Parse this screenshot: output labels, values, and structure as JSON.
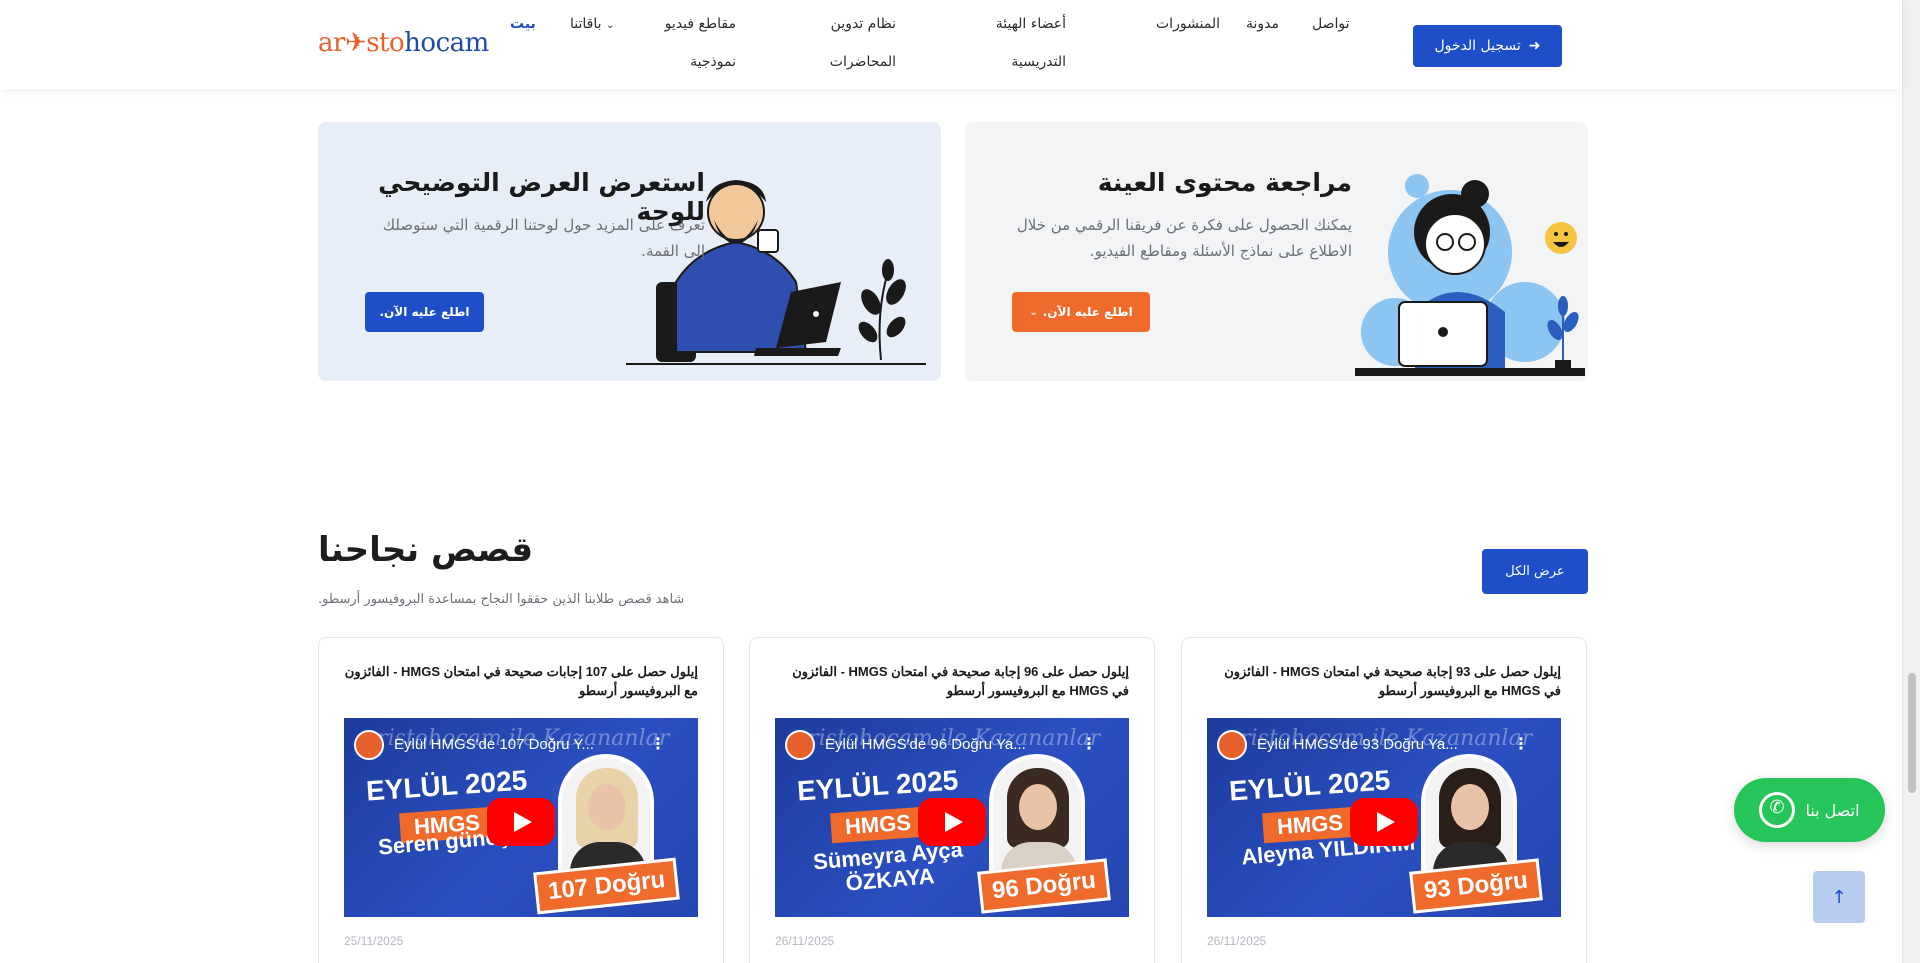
{
  "header": {
    "logo_part1": "ar✈sto",
    "logo_part2": "hocam",
    "nav": {
      "home": "بيت",
      "packages": "باقاتنا",
      "sample_videos_1": "مقاطع فيديو",
      "sample_videos_2": "نموذجية",
      "lecture_1": "نظام تدوين",
      "lecture_2": "المحاضرات",
      "faculty_1": "أعضاء الهيئة",
      "faculty_2": "التدريسية",
      "publications": "المنشورات",
      "blog": "مدونة",
      "contact": "تواصل"
    },
    "login_label": "تسجيل الدخول"
  },
  "promo": {
    "demo": {
      "title": "استعرض العرض التوضيحي للوحة",
      "desc_1": "تعرف على المزيد حول لوحتنا الرقمية التي ستوصلك",
      "desc_2": "إلى القمة.",
      "button": "اطلع عليه الآن."
    },
    "sample": {
      "title": "مراجعة محتوى العينة",
      "desc_1": "يمكنك الحصول على فكرة عن فريقنا الرقمي من خلال",
      "desc_2": "الاطلاع على نماذج الأسئلة ومقاطع الفيديو.",
      "button": "اطلع عليه الآن."
    }
  },
  "success": {
    "title": "قصص نجاحنا",
    "subtitle": "شاهد قصص طلابنا الذين حققوا النجاح بمساعدة البروفيسور أرسطو.",
    "view_all": "عرض الكل",
    "videos": [
      {
        "title": "إيلول حصل على 107 إجابات صحيحة في امتحان HMGS - الفائزون مع البروفيسور أرسطو",
        "yt_title": "Eylül HMGS'de 107 Doğru Y...",
        "watermark": "aristohocam ile Kazananlar",
        "year": "EYLÜL 2025",
        "exam": "HMGS",
        "person": "Seren güneş",
        "score": "107 Doğru",
        "date": "25/11/2025"
      },
      {
        "title": "إيلول حصل على 96 إجابة صحيحة في امتحان HMGS - الفائزون في HMGS مع البروفيسور أرسطو",
        "yt_title": "Eylül HMGS'de 96 Doğru Ya...",
        "watermark": "aristohocam ile Kazananlar",
        "year": "EYLÜL 2025",
        "exam": "HMGS",
        "person": "Sümeyra Ayça ÖZKAYA",
        "score": "96 Doğru",
        "date": "26/11/2025"
      },
      {
        "title": "إيلول حصل على 93 إجابة صحيحة في امتحان HMGS - الفائزون في HMGS مع البروفيسور أرسطو",
        "yt_title": "Eylül HMGS'de 93 Doğru Ya...",
        "watermark": "aristohocam ile Kazananlar",
        "year": "EYLÜL 2025",
        "exam": "HMGS",
        "person": "Aleyna YILDIRIM",
        "score": "93 Doğru",
        "date": "26/11/2025"
      }
    ]
  },
  "floating": {
    "whatsapp_label": "اتصل بنا",
    "to_top": "↑"
  },
  "colors": {
    "primary": "#1e4fc9",
    "accent": "#ef6a2b",
    "whatsapp": "#25c559",
    "demo_card_bg": "#e8eef8",
    "sample_card_bg": "#f3f4f6"
  },
  "icons": [
    "login-icon",
    "chevron-down-icon",
    "whatsapp-icon",
    "arrow-up-icon",
    "play-icon"
  ]
}
